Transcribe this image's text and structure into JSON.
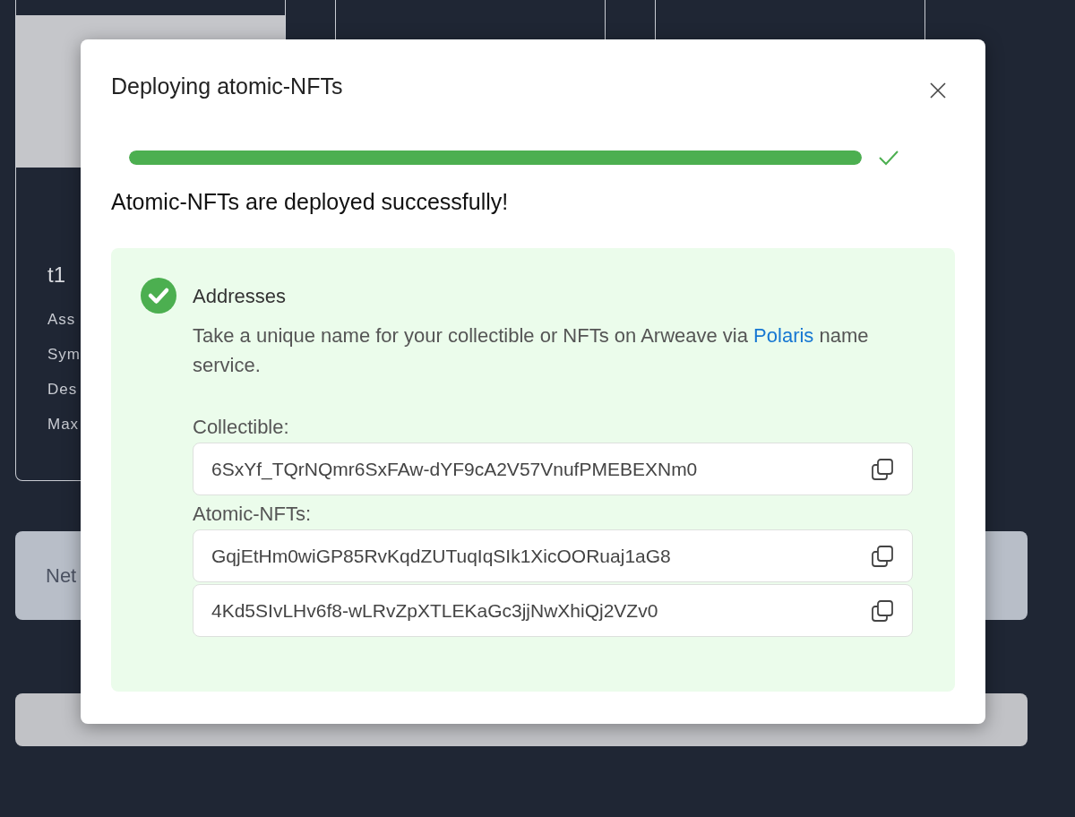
{
  "background": {
    "card": {
      "title": "t1",
      "labels": [
        "Ass",
        "Sym",
        "Des",
        "Max"
      ]
    },
    "network_bar": {
      "label": "Net"
    }
  },
  "dialog": {
    "title": "Deploying atomic-NFTs",
    "progress": {
      "level": 1,
      "done": true
    },
    "message": "Atomic-NFTs are deployed successfully!",
    "addresses": {
      "heading": "Addresses",
      "text_before": "Take a unique name for your collectible or NFTs on Arweave via ",
      "link": "Polaris",
      "text_after": " name service.",
      "groups": [
        {
          "label": "Collectible:",
          "values": [
            "6SxYf_TQrNQmr6SxFAw-dYF9cA2V57VnufPMEBEXNm0"
          ]
        },
        {
          "label": "Atomic-NFTs:",
          "values": [
            "GqjEtHm0wiGP85RvKqdZUTuqIqSIk1XicOORuaj1aG8",
            "4Kd5SIvLHv6f8-wLRvZpXTLEKaGc3jjNwXhiQj2VZv0"
          ]
        }
      ]
    }
  }
}
